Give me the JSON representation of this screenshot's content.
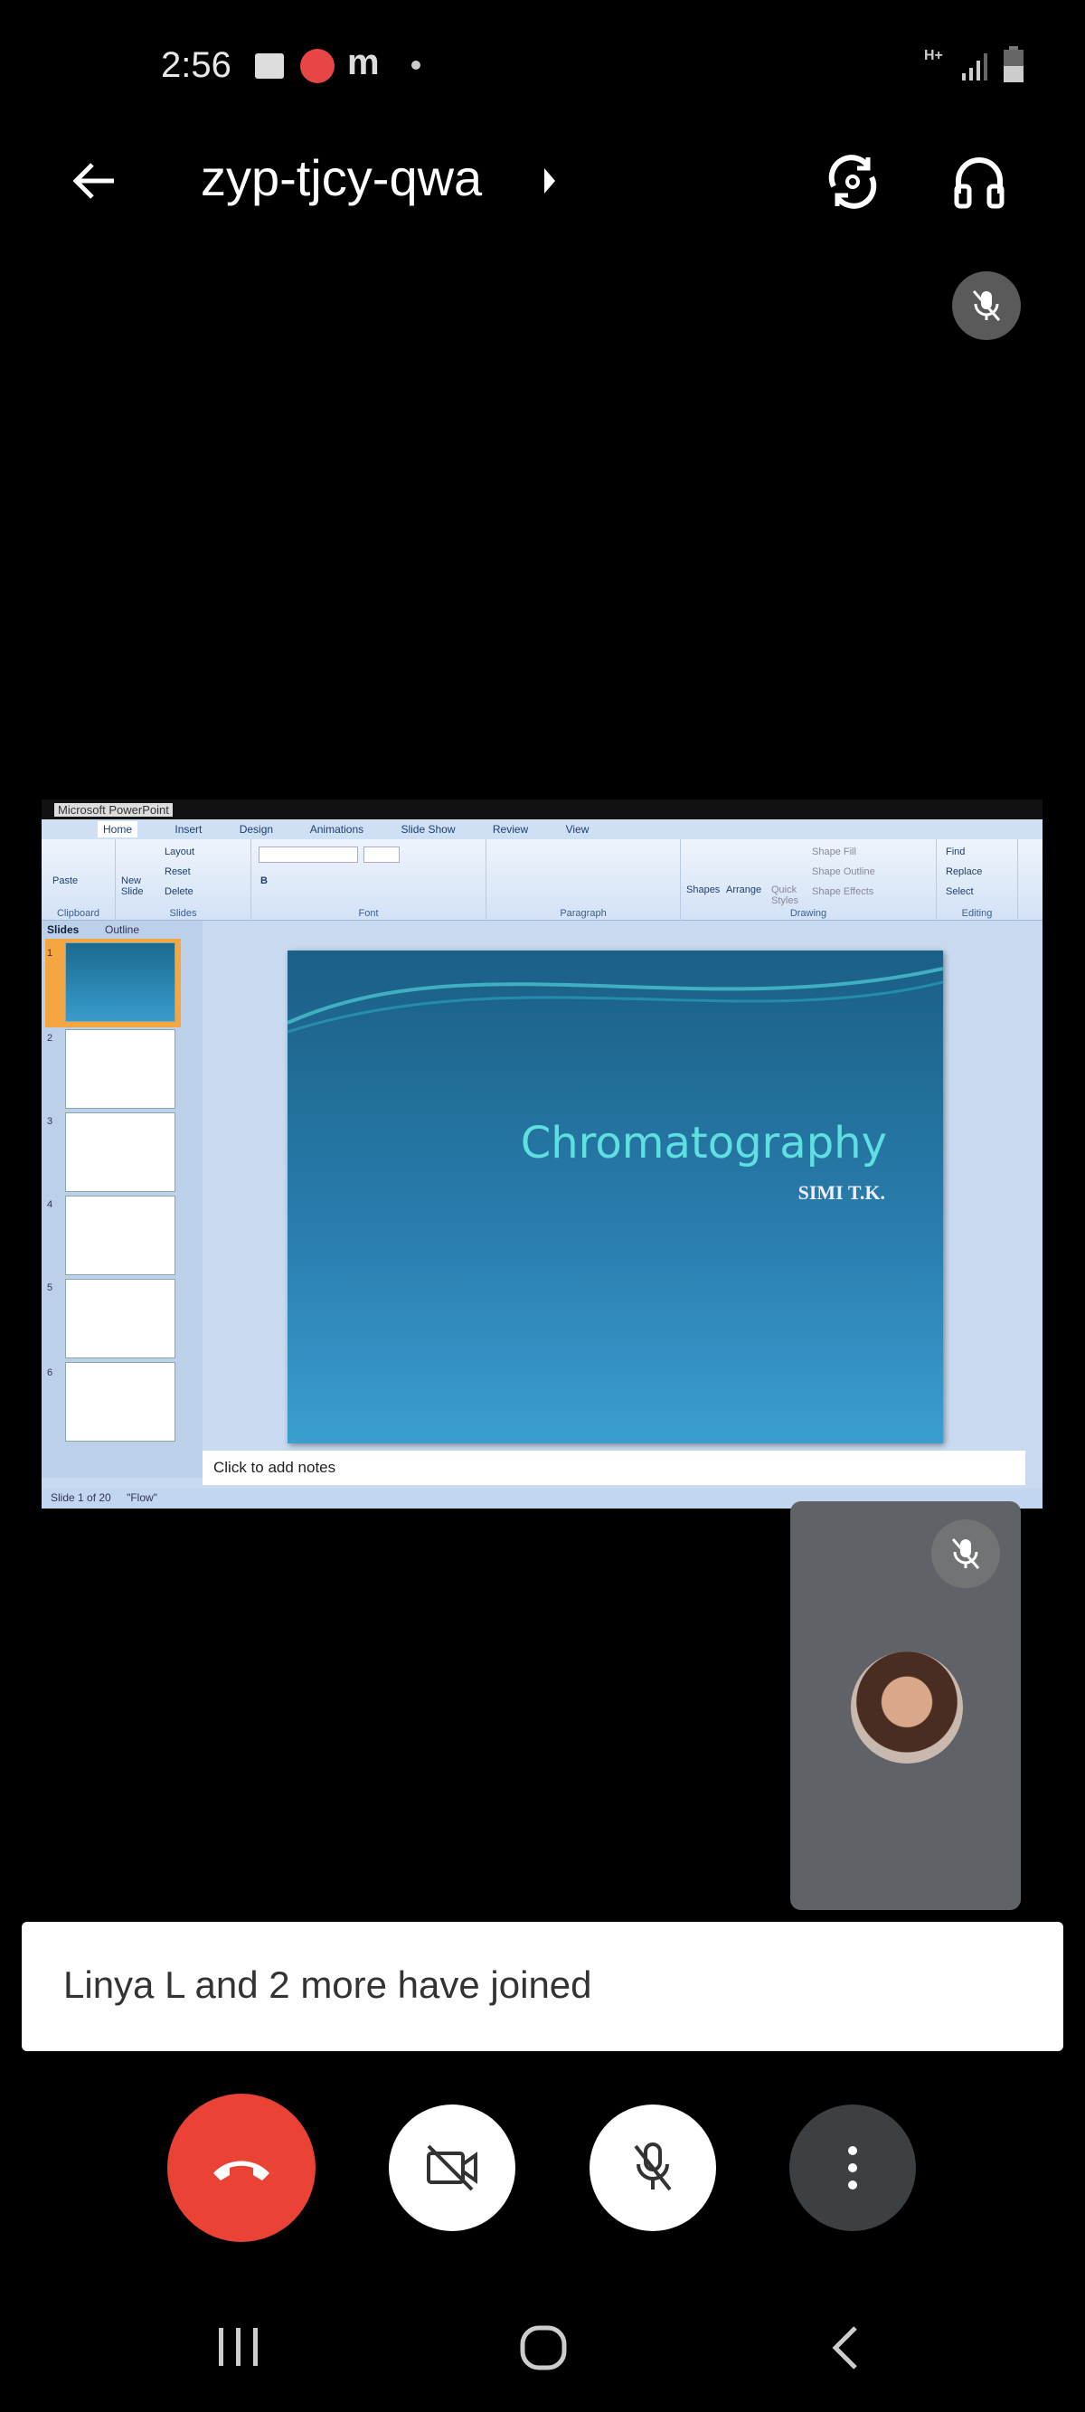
{
  "status_bar": {
    "time": "2:56",
    "notification_icons": [
      "gallery-icon",
      "app-101-icon",
      "m-icon",
      "dot"
    ],
    "network": "H+"
  },
  "header": {
    "meeting_code": "zyp-tjcy-qwa"
  },
  "presentation": {
    "window_app": "Microsoft PowerPoint",
    "tabs": [
      "Home",
      "Insert",
      "Design",
      "Animations",
      "Slide Show",
      "Review",
      "View"
    ],
    "ribbon_groups": [
      "Clipboard",
      "Slides",
      "Font",
      "Paragraph",
      "Drawing",
      "Editing"
    ],
    "ribbon_buttons": {
      "paste": "Paste",
      "new_slide": "New Slide",
      "layout": "Layout",
      "reset": "Reset",
      "delete": "Delete",
      "shapes": "Shapes",
      "arrange": "Arrange",
      "quick_styles": "Quick Styles",
      "shape_fill": "Shape Fill",
      "shape_outline": "Shape Outline",
      "shape_effects": "Shape Effects",
      "find": "Find",
      "replace": "Replace",
      "select": "Select"
    },
    "panel_tabs": [
      "Slides",
      "Outline"
    ],
    "thumbnails": [
      "1",
      "2",
      "3",
      "4",
      "5",
      "6"
    ],
    "slide_title": "Chromatography",
    "slide_subtitle": "SIMI T.K.",
    "notes_placeholder": "Click to add notes",
    "status": "Slide 1 of 20",
    "theme": "\"Flow\""
  },
  "toast": {
    "message": "Linya L and 2 more have joined"
  },
  "colors": {
    "end_call": "#ea4335",
    "accent_title": "#5fe0e0"
  }
}
